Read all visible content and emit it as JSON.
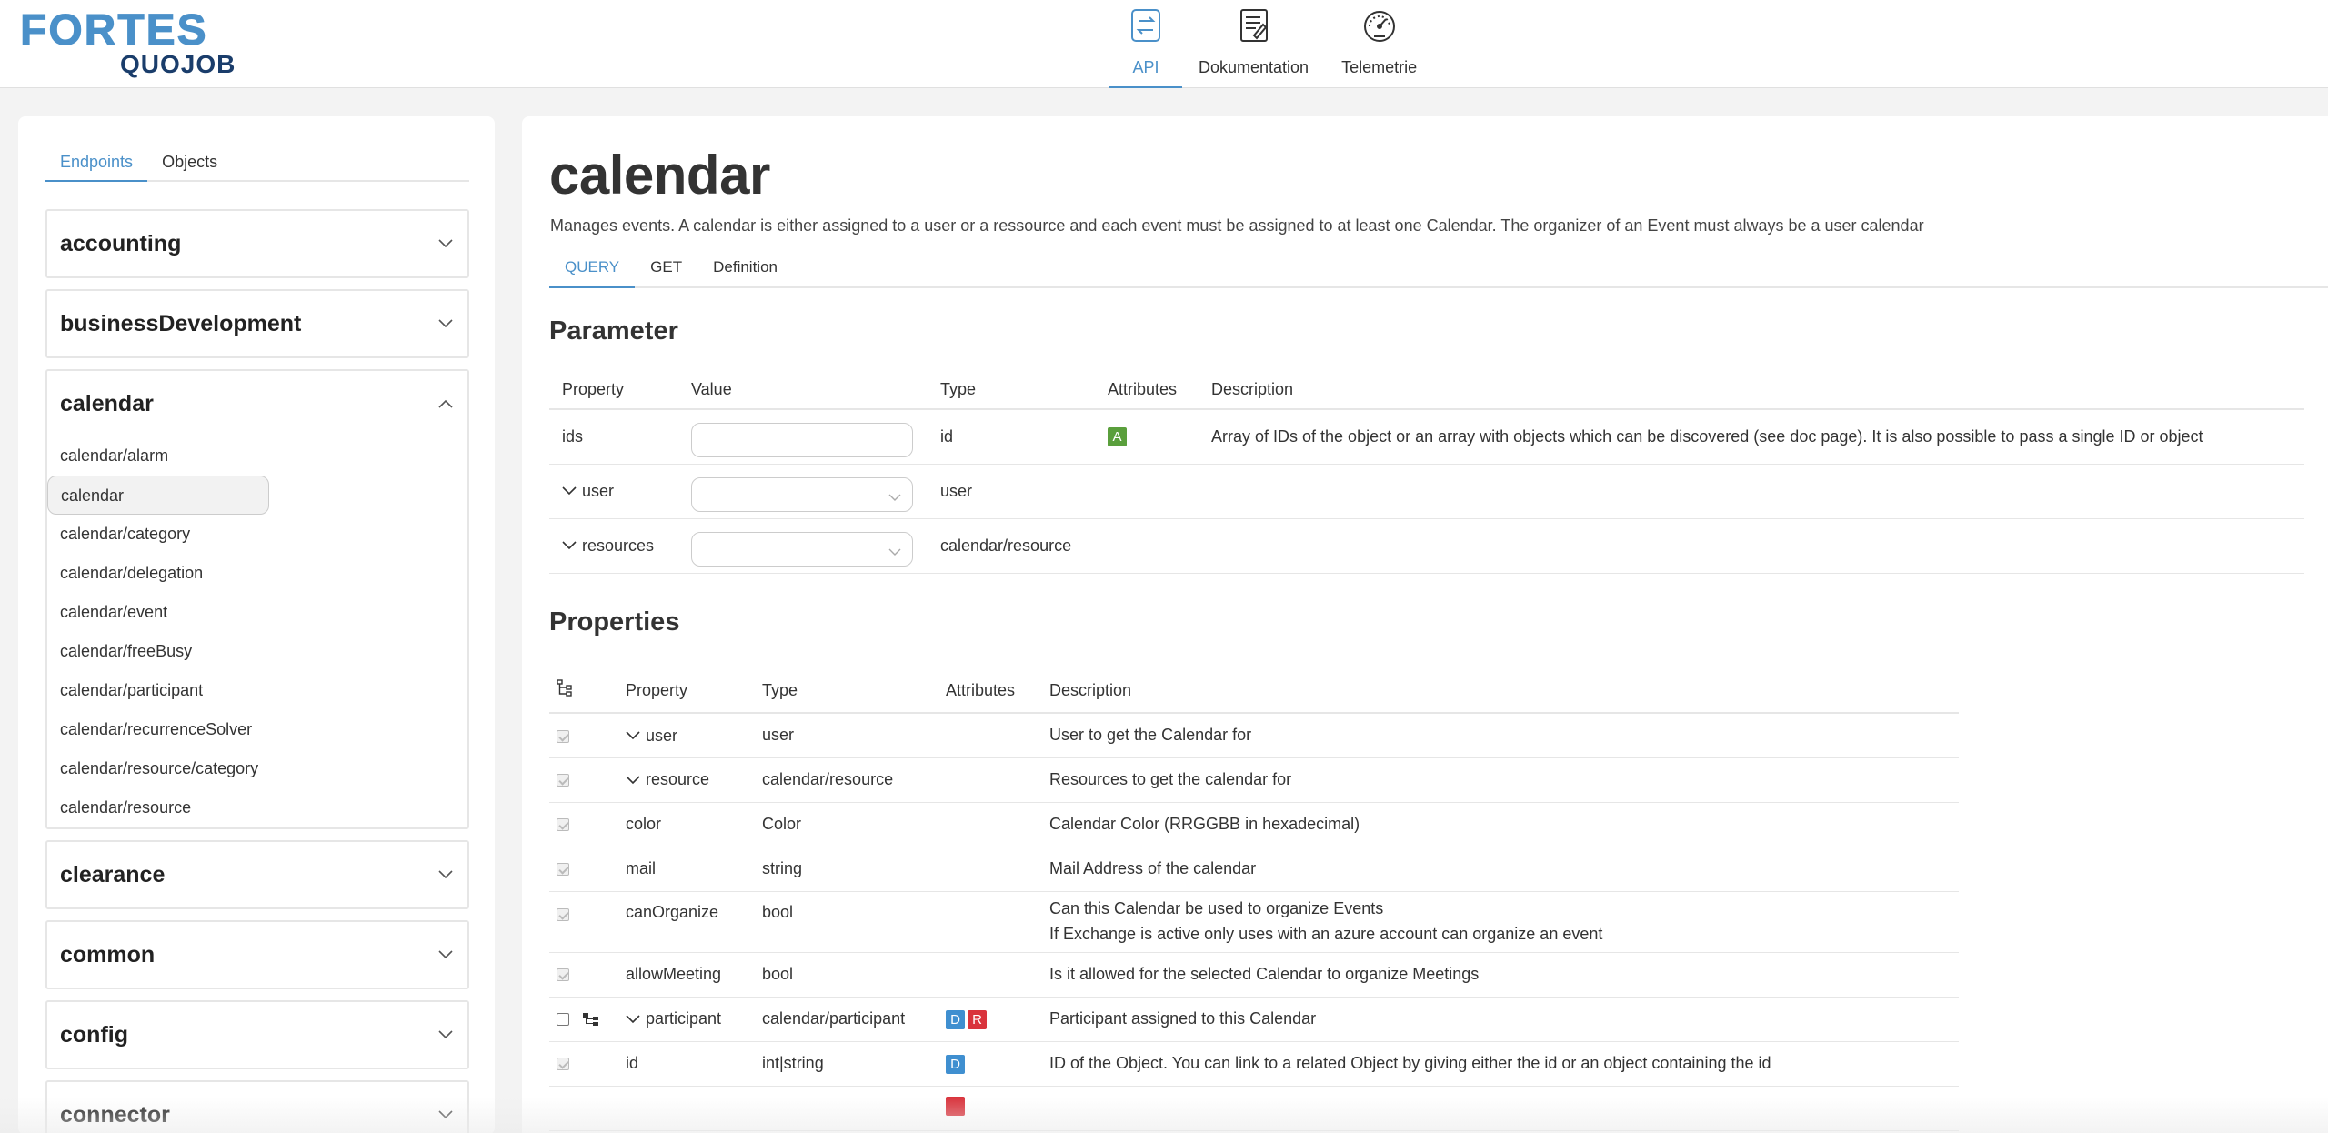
{
  "brand": {
    "top": "FORTES",
    "bottom": "QUOJOB"
  },
  "topnav": [
    {
      "label": "API",
      "icon": "api-sync-icon"
    },
    {
      "label": "Dokumentation",
      "icon": "document-icon"
    },
    {
      "label": "Telemetrie",
      "icon": "gauge-icon"
    }
  ],
  "sidebar": {
    "tabs": [
      "Endpoints",
      "Objects"
    ],
    "groups": [
      {
        "title": "accounting"
      },
      {
        "title": "businessDevelopment"
      },
      {
        "title": "calendar",
        "items": [
          "calendar/alarm",
          "calendar",
          "calendar/category",
          "calendar/delegation",
          "calendar/event",
          "calendar/freeBusy",
          "calendar/participant",
          "calendar/recurrenceSolver",
          "calendar/resource/category",
          "calendar/resource"
        ]
      },
      {
        "title": "clearance"
      },
      {
        "title": "common"
      },
      {
        "title": "config"
      },
      {
        "title": "connector"
      }
    ]
  },
  "page": {
    "title": "calendar",
    "description": "Manages events. A calendar is either assigned to a user or a ressource and each event must be assigned to at least one Calendar. The organizer of an Event must always be a user calendar",
    "tabs": [
      "QUERY",
      "GET",
      "Definition"
    ]
  },
  "parameter": {
    "heading": "Parameter",
    "columns": [
      "Property",
      "Value",
      "Type",
      "Attributes",
      "Description"
    ],
    "rows": [
      {
        "property": "ids",
        "type": "id",
        "attr": "A",
        "description": "Array of IDs of the object or an array with objects which can be discovered (see doc page). It is also possible to pass a single ID or object"
      },
      {
        "property": "user",
        "type": "user",
        "attr": "",
        "description": ""
      },
      {
        "property": "resources",
        "type": "calendar/resource",
        "attr": "",
        "description": ""
      }
    ]
  },
  "properties": {
    "heading": "Properties",
    "columns": [
      "",
      "Property",
      "Type",
      "Attributes",
      "Description"
    ],
    "rows": [
      {
        "property": "user",
        "type": "user",
        "description": "User to get the Calendar for"
      },
      {
        "property": "resource",
        "type": "calendar/resource",
        "description": "Resources to get the calendar for"
      },
      {
        "property": "color",
        "type": "Color",
        "description": "Calendar Color (RRGGBB in hexadecimal)"
      },
      {
        "property": "mail",
        "type": "string",
        "description": "Mail Address of the calendar"
      },
      {
        "property": "canOrganize",
        "type": "bool",
        "description": "Can this Calendar be used to organize Events",
        "description2": "If Exchange is active only uses with an azure account can organize an event"
      },
      {
        "property": "allowMeeting",
        "type": "bool",
        "description": "Is it allowed for the selected Calendar to organize Meetings"
      },
      {
        "property": "participant",
        "type": "calendar/participant",
        "badges": [
          "D",
          "R"
        ],
        "description": "Participant assigned to this Calendar"
      },
      {
        "property": "id",
        "type": "int|string",
        "badges": [
          "D"
        ],
        "description": "ID of the Object. You can link to a related Object by giving either the id or an object containing the id"
      }
    ]
  },
  "colors": {
    "accent": "#4a90c9",
    "badge_a": "#5a9f3c",
    "badge_d": "#3f8fd0",
    "badge_r": "#d9333c"
  }
}
